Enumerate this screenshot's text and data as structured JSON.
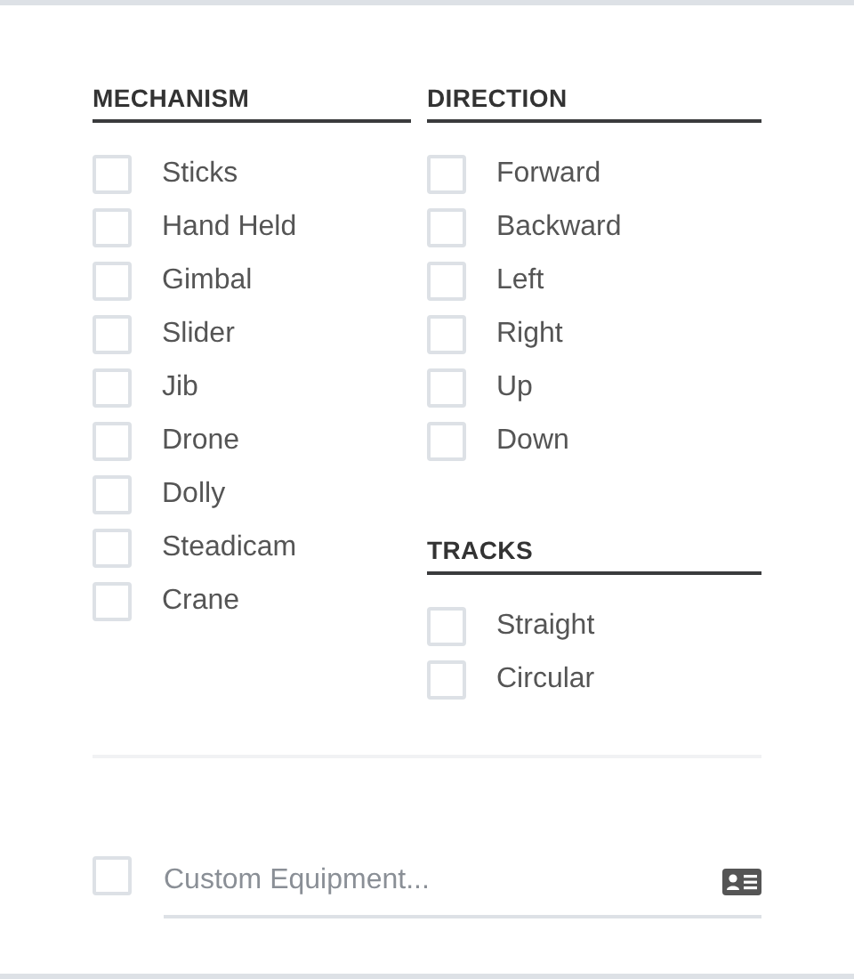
{
  "groups": [
    {
      "title": "MECHANISM",
      "items": [
        {
          "label": "Sticks",
          "checked": false
        },
        {
          "label": "Hand Held",
          "checked": false
        },
        {
          "label": "Gimbal",
          "checked": false
        },
        {
          "label": "Slider",
          "checked": false
        },
        {
          "label": "Jib",
          "checked": false
        },
        {
          "label": "Drone",
          "checked": false
        },
        {
          "label": "Dolly",
          "checked": false
        },
        {
          "label": "Steadicam",
          "checked": false
        },
        {
          "label": "Crane",
          "checked": false
        }
      ]
    },
    {
      "title": "DIRECTION",
      "items": [
        {
          "label": "Forward",
          "checked": false
        },
        {
          "label": "Backward",
          "checked": false
        },
        {
          "label": "Left",
          "checked": false
        },
        {
          "label": "Right",
          "checked": false
        },
        {
          "label": "Up",
          "checked": false
        },
        {
          "label": "Down",
          "checked": false
        }
      ]
    },
    {
      "title": "TRACKS",
      "items": [
        {
          "label": "Straight",
          "checked": false
        },
        {
          "label": "Circular",
          "checked": false
        }
      ]
    }
  ],
  "custom": {
    "checked": false,
    "placeholder": "Custom Equipment..."
  }
}
